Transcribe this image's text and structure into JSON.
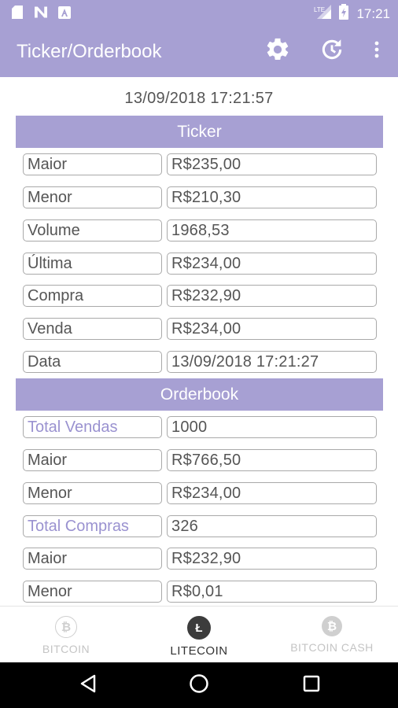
{
  "status_bar": {
    "time": "17:21",
    "network_label": "LTE",
    "icons": [
      "sd-card-icon",
      "n-notification-icon",
      "a-notification-icon",
      "signal-icon",
      "battery-icon"
    ]
  },
  "app_bar": {
    "title": "Ticker/Orderbook",
    "icons": [
      "settings-gear-icon",
      "refresh-icon",
      "more-vert-icon"
    ]
  },
  "timestamp": "13/09/2018 17:21:57",
  "ticker": {
    "header": "Ticker",
    "rows": [
      {
        "label": "Maior",
        "value": "R$235,00"
      },
      {
        "label": "Menor",
        "value": "R$210,30"
      },
      {
        "label": "Volume",
        "value": "1968,53"
      },
      {
        "label": "Última",
        "value": "R$234,00"
      },
      {
        "label": "Compra",
        "value": "R$232,90"
      },
      {
        "label": "Venda",
        "value": "R$234,00"
      },
      {
        "label": "Data",
        "value": "13/09/2018 17:21:27"
      }
    ]
  },
  "orderbook": {
    "header": "Orderbook",
    "rows": [
      {
        "label": "Total Vendas",
        "value": "1000"
      },
      {
        "label": "Maior",
        "value": "R$766,50"
      },
      {
        "label": "Menor",
        "value": "R$234,00"
      },
      {
        "label": "Total Compras",
        "value": "326"
      },
      {
        "label": "Maior",
        "value": "R$232,90"
      },
      {
        "label": "Menor",
        "value": "R$0,01"
      }
    ]
  },
  "bottom_nav": {
    "items": [
      {
        "label": "BITCOIN",
        "glyph": "₿",
        "selected": false
      },
      {
        "label": "LITECOIN",
        "glyph": "Ł",
        "selected": true
      },
      {
        "label": "BITCOIN CASH",
        "glyph": "₿",
        "selected": false
      }
    ]
  },
  "colors": {
    "primary": "#a7a0d3",
    "accent_text": "#9a92d0",
    "cell_border": "#a9a9a9",
    "text": "#555555"
  }
}
